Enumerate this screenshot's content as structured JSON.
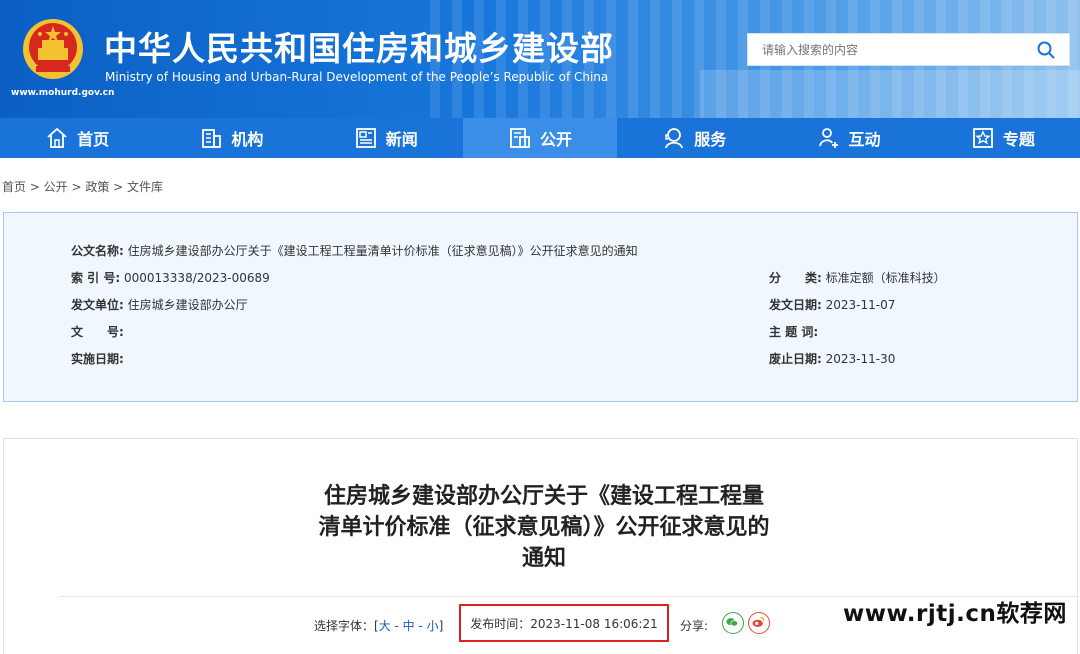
{
  "header": {
    "title_cn": "中华人民共和国住房和城乡建设部",
    "title_en": "Ministry of Housing and Urban-Rural Development of the People’s Republic of China",
    "domain": "www.mohurd.gov.cn",
    "search_placeholder": "请输入搜索的内容"
  },
  "nav": {
    "items": [
      {
        "label": "首页",
        "icon": "home-icon"
      },
      {
        "label": "机构",
        "icon": "building-icon"
      },
      {
        "label": "新闻",
        "icon": "news-icon"
      },
      {
        "label": "公开",
        "icon": "open-doc-icon",
        "active": true
      },
      {
        "label": "服务",
        "icon": "service-icon"
      },
      {
        "label": "互动",
        "icon": "interact-icon"
      },
      {
        "label": "专题",
        "icon": "star-icon"
      }
    ]
  },
  "breadcrumb": "首页 > 公开 > 政策 > 文件库",
  "meta": {
    "title_label": "公文名称:",
    "title_value": "住房城乡建设部办公厅关于《建设工程工程量清单计价标准（征求意见稿）》公开征求意见的通知",
    "index_label": "索 引 号:",
    "index_value": "000013338/2023-00689",
    "category_label": "分　　类:",
    "category_value": "标准定额（标准科技）",
    "issuer_label": "发文单位:",
    "issuer_value": "住房城乡建设部办公厅",
    "issue_date_label": "发文日期:",
    "issue_date_value": "2023-11-07",
    "doc_no_label": "文　　号:",
    "doc_no_value": "",
    "keywords_label": "主 题 词:",
    "keywords_value": "",
    "effective_label": "实施日期:",
    "effective_value": "",
    "expire_label": "废止日期:",
    "expire_value": "2023-11-30"
  },
  "article": {
    "title": "住房城乡建设部办公厅关于《建设工程工程量清单计价标准（征求意见稿）》公开征求意见的通知",
    "font_select_label": "选择字体：[",
    "font_large": "大",
    "font_medium": "中",
    "font_small": "小",
    "font_select_end": "]",
    "publish_time": "发布时间：2023-11-08 16:06:21",
    "share_label": "分享:"
  },
  "watermark": "www.rjtj.cn软荐网",
  "colors": {
    "nav": "#1a73d9",
    "nav_active": "#3b8ee8",
    "highlight_box": "#e02020",
    "meta_bg": "#f1f7fe"
  }
}
